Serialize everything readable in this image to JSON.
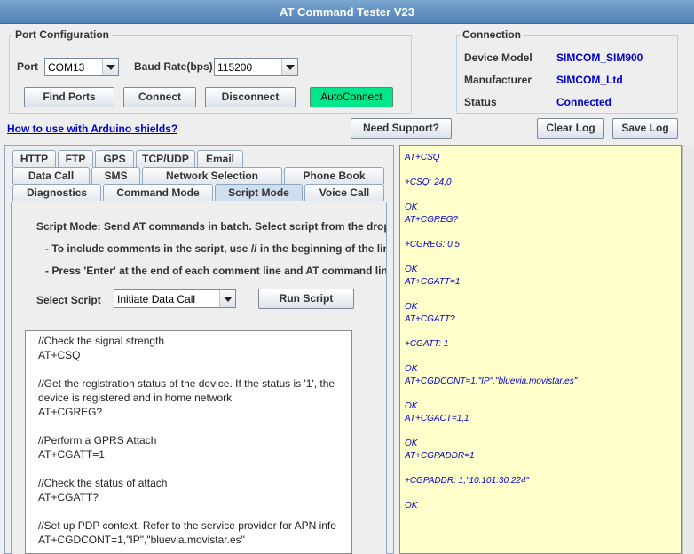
{
  "window": {
    "title": "AT Command Tester V23"
  },
  "port_config": {
    "legend": "Port Configuration",
    "port_label": "Port",
    "port_value": "COM13",
    "baud_label": "Baud Rate(bps)",
    "baud_value": "115200",
    "find_ports": "Find Ports",
    "connect": "Connect",
    "disconnect": "Disconnect",
    "autoconnect": "AutoConnect"
  },
  "connection": {
    "legend": "Connection",
    "device_model_label": "Device Model",
    "device_model": "SIMCOM_SIM900",
    "manufacturer_label": "Manufacturer",
    "manufacturer": "SIMCOM_Ltd",
    "status_label": "Status",
    "status": "Connected"
  },
  "toolbar": {
    "arduino_link": "How to use with Arduino shields?",
    "need_support": "Need Support?",
    "clear_log": "Clear Log",
    "save_log": "Save Log"
  },
  "tabs": {
    "row1": [
      "HTTP",
      "FTP",
      "GPS",
      "TCP/UDP",
      "Email"
    ],
    "row2": [
      "Data Call",
      "SMS",
      "Network Selection",
      "Phone Book"
    ],
    "row3": [
      "Diagnostics",
      "Command Mode",
      "Script Mode",
      "Voice Call"
    ],
    "active": "Script Mode"
  },
  "script_mode": {
    "description": "Script Mode: Send AT commands in batch. Select script from the drop",
    "note1": "- To include comments in the script, use // in the beginning of the line",
    "note2": "- Press 'Enter' at the end of each comment line and AT command line",
    "select_label": "Select Script",
    "selected_script": "Initiate Data Call",
    "run_script": "Run Script"
  },
  "script_lines": [
    "//Check the signal strength",
    "AT+CSQ",
    "",
    "//Get the registration status of the device. If the status is '1', the",
    "device is registered and in home network",
    "AT+CGREG?",
    "",
    "//Perform a GPRS Attach",
    "AT+CGATT=1",
    "",
    "//Check the status of attach",
    "AT+CGATT?",
    "",
    "//Set up PDP context. Refer to the service provider for APN info",
    "AT+CGDCONT=1,\"IP\",\"bluevia.movistar.es\""
  ],
  "log_lines": [
    "AT+CSQ",
    "",
    "+CSQ: 24,0",
    "",
    "OK",
    "AT+CGREG?",
    "",
    "+CGREG: 0,5",
    "",
    "OK",
    "AT+CGATT=1",
    "",
    "OK",
    "AT+CGATT?",
    "",
    "+CGATT: 1",
    "",
    "OK",
    "AT+CGDCONT=1,\"IP\",\"bluevia.movistar.es\"",
    "",
    "OK",
    "AT+CGACT=1,1",
    "",
    "OK",
    "AT+CGPADDR=1",
    "",
    "+CGPADDR: 1,\"10.101.30.224\"",
    "",
    "OK"
  ]
}
